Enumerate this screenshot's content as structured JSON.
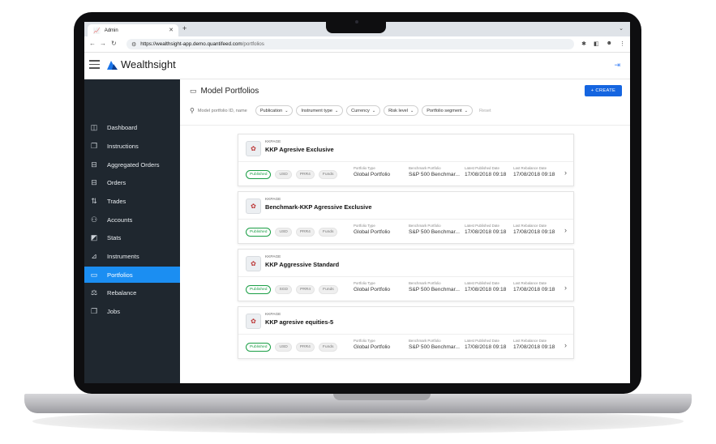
{
  "browser": {
    "tab_title": "Admin",
    "new_tab": "+",
    "url_host": "https://wealthsight-app.demo.quantifeed.com",
    "url_path": "/portfolios"
  },
  "header": {
    "brand": "Wealthsight"
  },
  "sidebar": {
    "items": [
      {
        "label": "Dashboard",
        "icon": "dashboard-icon",
        "glyph": "◫"
      },
      {
        "label": "Instructions",
        "icon": "instructions-icon",
        "glyph": "❐"
      },
      {
        "label": "Aggregated Orders",
        "icon": "aggregated-orders-icon",
        "glyph": "⊟"
      },
      {
        "label": "Orders",
        "icon": "orders-icon",
        "glyph": "⊟"
      },
      {
        "label": "Trades",
        "icon": "trades-icon",
        "glyph": "⇅"
      },
      {
        "label": "Accounts",
        "icon": "accounts-icon",
        "glyph": "⚇"
      },
      {
        "label": "Stats",
        "icon": "stats-icon",
        "glyph": "◩"
      },
      {
        "label": "Instruments",
        "icon": "instruments-icon",
        "glyph": "⊿"
      },
      {
        "label": "Portfolios",
        "icon": "portfolios-icon",
        "glyph": "▭",
        "active": true
      },
      {
        "label": "Rebalance",
        "icon": "rebalance-icon",
        "glyph": "⚖"
      },
      {
        "label": "Jobs",
        "icon": "jobs-icon",
        "glyph": "❐"
      }
    ]
  },
  "page": {
    "title": "Model Portfolios",
    "create_label": "+ CREATE",
    "search_placeholder": "Model portfolio ID, name",
    "filters": [
      "Publication",
      "Instrument type",
      "Currency",
      "Risk level",
      "Portfolio segment"
    ],
    "reset_label": "Reset"
  },
  "field_labels": {
    "type": "Portfolio Type",
    "benchmark": "Benchmark Portfolio",
    "published": "Latest Published Date",
    "rebalance": "Last Rebalance Date"
  },
  "portfolios": [
    {
      "code": "KKPAGE",
      "name": "KKP Agresive Exclusive",
      "status": "Published",
      "currency": "USD",
      "risk": "PRR4",
      "kind": "Funds",
      "type": "Global Portfolio",
      "benchmark": "S&P 500 Benchmar...",
      "published": "17/08/2018 09:18",
      "rebalance": "17/08/2018 09:18"
    },
    {
      "code": "KKPAGE",
      "name": "Benchmark-KKP Agressive Exclusive",
      "status": "Published",
      "currency": "USD",
      "risk": "PRR4",
      "kind": "Funds",
      "type": "Global Portfolio",
      "benchmark": "S&P 500 Benchmar...",
      "published": "17/08/2018 09:18",
      "rebalance": "17/08/2018 09:18"
    },
    {
      "code": "KKPAGE",
      "name": "KKP Aggressive Standard",
      "status": "Published",
      "currency": "SGD",
      "risk": "PRR4",
      "kind": "Funds",
      "type": "Global Portfolio",
      "benchmark": "S&P 500 Benchmar...",
      "published": "17/08/2018 09:18",
      "rebalance": "17/08/2018 09:18"
    },
    {
      "code": "KKPAGE",
      "name": "KKP agresive equities-5",
      "status": "Published",
      "currency": "USD",
      "risk": "PRR4",
      "kind": "Funds",
      "type": "Global Portfolio",
      "benchmark": "S&P 500 Benchmar...",
      "published": "17/08/2018 09:18",
      "rebalance": "17/08/2018 09:18"
    }
  ],
  "colors": {
    "sidebar_bg": "#1f272f",
    "active_item": "#1b8ef2",
    "create_button": "#1565e0",
    "published_badge": "#1a9e45"
  }
}
